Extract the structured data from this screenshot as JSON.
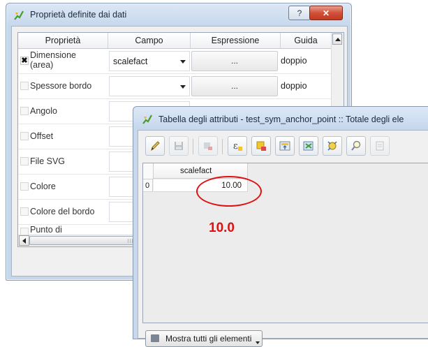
{
  "window1": {
    "title": "Proprietà definite dai dati",
    "help_label": "?",
    "close_label": "✕",
    "columns": [
      "Proprietà",
      "Campo",
      "Espressione",
      "Guida"
    ],
    "rows": [
      {
        "checked": true,
        "property": "Dimensione\n(area)",
        "field": "scalefact",
        "expression": "...",
        "guide": "doppio"
      },
      {
        "checked": false,
        "property": "Spessore bordo",
        "field": "",
        "expression": "...",
        "guide": "doppio"
      },
      {
        "checked": false,
        "property": "Angolo",
        "field": "",
        "expression": "",
        "guide": ""
      },
      {
        "checked": false,
        "property": "Offset",
        "field": "",
        "expression": "",
        "guide": ""
      },
      {
        "checked": false,
        "property": "File SVG",
        "field": "",
        "expression": "",
        "guide": ""
      },
      {
        "checked": false,
        "property": "Colore",
        "field": "",
        "expression": "",
        "guide": ""
      },
      {
        "checked": false,
        "property": "Colore del bordo",
        "field": "",
        "expression": "",
        "guide": ""
      },
      {
        "checked": false,
        "property": "Punto di",
        "field": "",
        "expression": "",
        "guide": ""
      }
    ]
  },
  "window2": {
    "title": "Tabella degli attributi - test_sym_anchor_point :: Totale degli ele",
    "toolbar_icons": [
      "edit-pencil-icon",
      "save-icon",
      "delete-selected-icon",
      "expression-select-icon",
      "deselect-icon",
      "move-selection-top-icon",
      "invert-selection-icon",
      "copy-rows-icon",
      "zoom-to-selection-icon",
      "new-column-icon"
    ],
    "table": {
      "column_header": "scalefact",
      "row_number": "0",
      "value": "10.00"
    },
    "annotation_value": "10.0",
    "show_all_button": "Mostra tutti gli elementi"
  },
  "colors": {
    "annotation": "#e01010",
    "titlebar": "#c7d8ed"
  }
}
